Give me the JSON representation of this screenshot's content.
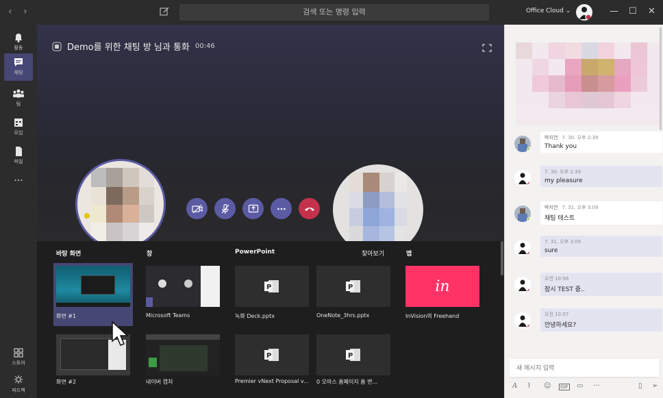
{
  "titlebar": {
    "search_placeholder": "검색 또는 명령 입력",
    "tenant_label": "Office Cloud ⌄",
    "back_glyph": "‹",
    "forward_glyph": "›",
    "minimize_glyph": "—",
    "maximize_glyph": "☐",
    "close_glyph": "✕"
  },
  "rail": {
    "items": [
      {
        "label": "활동",
        "icon": "bell-icon"
      },
      {
        "label": "채팅",
        "icon": "chat-icon"
      },
      {
        "label": "팀",
        "icon": "teams-icon"
      },
      {
        "label": "모임",
        "icon": "calendar-icon"
      },
      {
        "label": "파일",
        "icon": "file-icon"
      }
    ],
    "more_glyph": "···",
    "store_label": "스토어",
    "feedback_label": "피드백"
  },
  "call": {
    "title": "Demo를 위한 채팅 방 님과 통화",
    "duration": "00:46"
  },
  "share_tray": {
    "headers": {
      "desktop": "바탕 화면",
      "window": "창",
      "powerpoint": "PowerPoint",
      "browse": "찾아보기",
      "apps": "앱"
    },
    "tiles": {
      "desktop1": "화면 #1",
      "desktop2": "화면 #2",
      "window1": "Microsoft Teams",
      "window2": "네이버 캡처",
      "ppt1": "녹화 Deck.pptx",
      "ppt2": "OneNote_3hrs.pptx",
      "ppt3": "Premier vNext Proposal v...",
      "ppt4": "0 오마스 홈페이지 홈 변...",
      "app1": "InVision의 Freehand",
      "invision_logo": "in"
    }
  },
  "chat": {
    "messages": [
      {
        "author": "박지연",
        "time": "7. 30. 오후 2:39",
        "text": "Thank you",
        "side": "other"
      },
      {
        "author": "",
        "time": "7. 30. 오후 2:39",
        "text": "my pleasure",
        "side": "mine"
      },
      {
        "author": "박지연",
        "time": "7. 31. 오후 3:09",
        "text": "채팅 테스트",
        "side": "other"
      },
      {
        "author": "",
        "time": "7. 31. 오후 3:09",
        "text": "sure",
        "side": "mine"
      },
      {
        "author": "",
        "time": "오전 10:56",
        "text": "잠시 TEST 중..",
        "side": "mine"
      },
      {
        "author": "",
        "time": "오전 10:57",
        "text": "안녕하세요?",
        "side": "mine"
      }
    ],
    "compose_placeholder": "새 메시지 입력"
  },
  "colors": {
    "accent": "#5b5ba4",
    "end_call": "#c4314b",
    "rail_active": "#464775",
    "invision": "#ff3366",
    "presence_available": "#6bb700",
    "presence_busy": "#c4314b"
  }
}
